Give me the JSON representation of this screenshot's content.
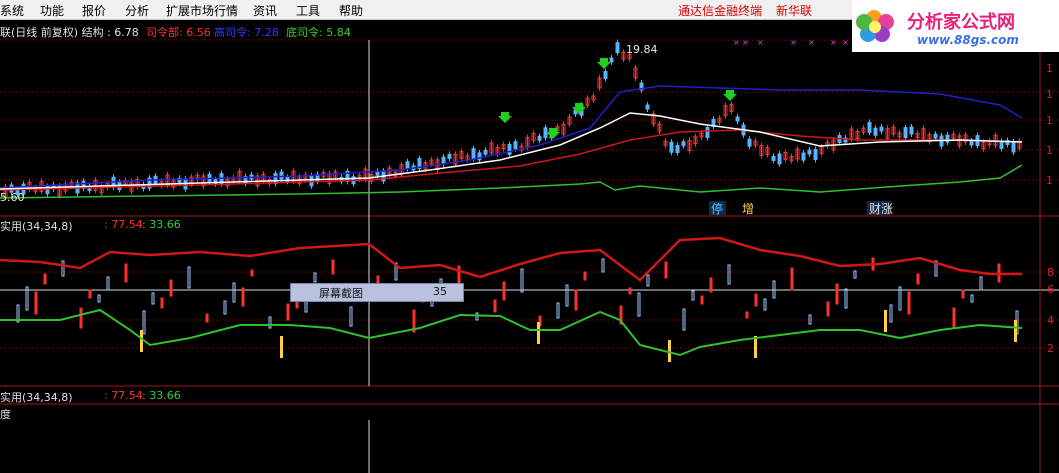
{
  "menubar": {
    "items": [
      "系统",
      "功能",
      "报价",
      "分析",
      "扩展市场行情",
      "资讯",
      "工具",
      "帮助"
    ],
    "app_title": "通达信金融终端",
    "broker": "新华联"
  },
  "logo": {
    "brand": "分析家公式网",
    "site": "www.88gs.com"
  },
  "main_panel": {
    "title_prefix": "联(日线 前复权) 结构 : 6.78",
    "commander": "司令部: 6.56",
    "high_commander": "高司令: 7.28",
    "low_commander": "底司令: 5.84",
    "peak_label": "19.84",
    "low_price_label": "5.60",
    "events": [
      "停",
      "增",
      "财涨"
    ],
    "right_axis": [
      "1",
      "1",
      "1",
      "1",
      "1",
      "1"
    ]
  },
  "indicator_panel_1": {
    "name": "实用(34,34,8)",
    "val_red": ": 77.54",
    "val_green": ": 33.66",
    "right_axis": [
      "8",
      "6",
      "4",
      "2"
    ]
  },
  "indicator_panel_2": {
    "name": "实用(34,34,8)",
    "val_red": ": 77.54",
    "val_green": ": 33.66",
    "sub_label": "度"
  },
  "popup": {
    "label": "屏幕截图",
    "value": "35"
  },
  "colors": {
    "background": "#000000",
    "red_line": "#d01818",
    "blue_line": "#2020c8",
    "white_line": "#ffffff",
    "green_line": "#30c030",
    "candle_up": "#ff3030",
    "candle_down": "#54b4ff",
    "panel_border": "#a01818",
    "arrow": "#20d020"
  }
}
